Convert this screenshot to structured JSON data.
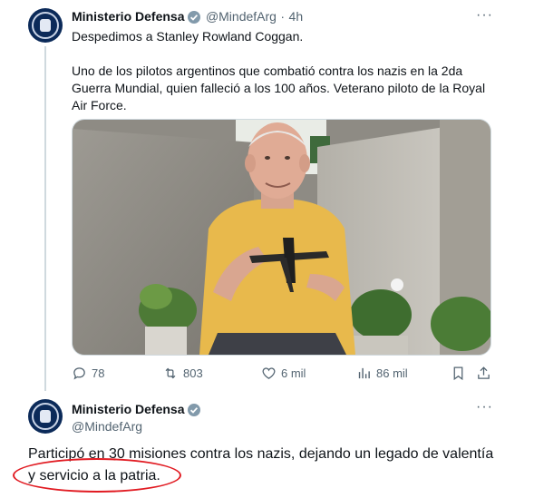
{
  "tweet1": {
    "author_name": "Ministerio Defensa",
    "handle": "@MindefArg",
    "separator": "·",
    "time": "4h",
    "more_label": "···",
    "text_line1": "Despedimos a Stanley Rowland Coggan.",
    "text_para2": "Uno de los pilotos argentinos que combatió contra los nazis en la 2da Guerra Mundial, quien falleció a los 100 años. Veterano piloto de la Royal Air Force.",
    "actions": {
      "replies": "78",
      "reposts": "803",
      "likes": "6 mil",
      "views": "86 mil"
    }
  },
  "tweet2": {
    "author_name": "Ministerio Defensa",
    "handle": "@MindefArg",
    "more_label": "···",
    "text": "Participó en 30 misiones contra los nazis, dejando un legado de valentía y servicio a la patria."
  },
  "colors": {
    "muted": "#536471",
    "verified": "#829aab",
    "annotation": "#e11b22",
    "avatar": "#0b2a59"
  },
  "icons": [
    "reply-icon",
    "repost-icon",
    "like-icon",
    "views-icon",
    "bookmark-icon",
    "share-icon",
    "verified-badge-icon",
    "more-icon"
  ]
}
